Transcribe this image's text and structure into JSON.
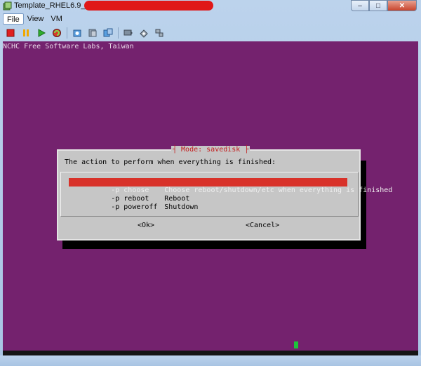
{
  "window": {
    "title": "Template_RHEL6.9_OS_x64",
    "buttons": {
      "minimize": "–",
      "maximize": "□",
      "close": "✕"
    }
  },
  "menu": {
    "items": [
      "File",
      "View",
      "VM"
    ]
  },
  "toolbar": {
    "icons": [
      "stop-icon",
      "pause-icon",
      "play-icon",
      "reset-icon",
      "snapshot-icon",
      "revert-snapshot-icon",
      "manage-snapshots-icon",
      "console-icon",
      "settings-icon",
      "network-icon"
    ]
  },
  "console": {
    "header": "NCHC Free Software Labs, Taiwan",
    "dialog": {
      "title": "┤ Mode: savedisk ├",
      "prompt": "The action to perform when everything is finished:",
      "options": [
        {
          "tag": "-p choose",
          "desc": "Choose reboot/shutdown/etc when everything is finished",
          "selected": true
        },
        {
          "tag": "-p reboot",
          "desc": "Reboot",
          "selected": false
        },
        {
          "tag": "-p poweroff",
          "desc": "Shutdown",
          "selected": false
        }
      ],
      "ok_label": "<Ok>",
      "cancel_label": "<Cancel>"
    }
  },
  "colors": {
    "console_bg": "#74226e",
    "selection_bg": "#d8322a",
    "dialog_title": "#c41e1e"
  }
}
